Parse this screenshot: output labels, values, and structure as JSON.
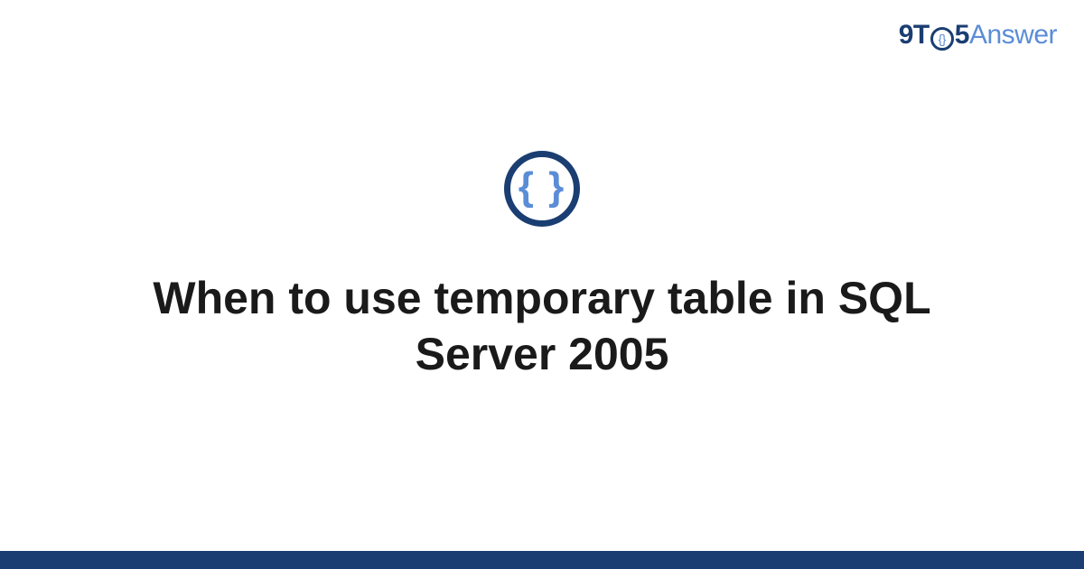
{
  "logo": {
    "part1": "9T",
    "icon_inner": "{}",
    "part2": "5",
    "part3": "Answer"
  },
  "main": {
    "icon_content": "{ }",
    "title": "When to use temporary table in SQL Server 2005"
  }
}
